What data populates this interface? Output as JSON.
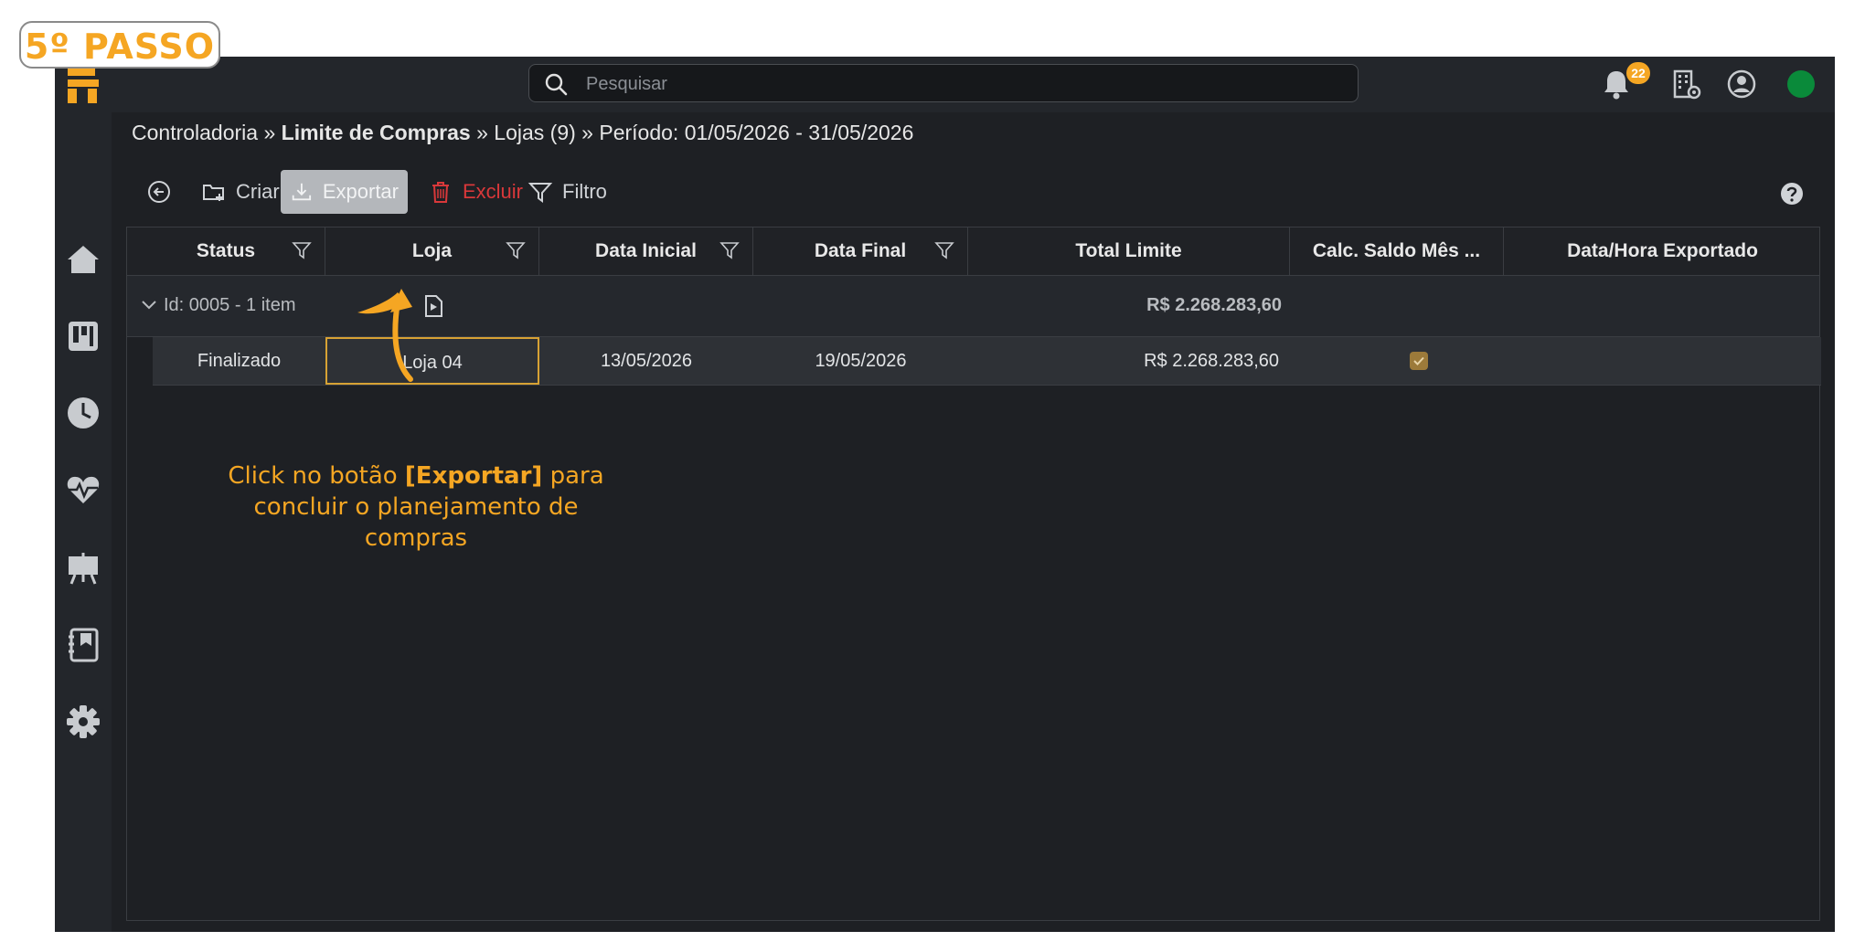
{
  "step_badge": "5º PASSO",
  "search": {
    "placeholder": "Pesquisar"
  },
  "notifications": {
    "count": "22"
  },
  "breadcrumb": {
    "part1": "Controladoria",
    "sep": " » ",
    "part2": "Limite de Compras",
    "part3": "Lojas (9)",
    "part4": "Período: 01/05/2026 - 31/05/2026"
  },
  "toolbar": {
    "create_label": "Criar",
    "export_label": "Exportar",
    "delete_label": "Excluir",
    "filter_label": "Filtro"
  },
  "table": {
    "columns": [
      "Status",
      "Loja",
      "Data Inicial",
      "Data Final",
      "Total Limite",
      "Calc. Saldo Mês ...",
      "Data/Hora Exportado"
    ],
    "group": {
      "label": "Id: 0005 - 1 item",
      "total": "R$ 2.268.283,60"
    },
    "rows": [
      {
        "status": "Finalizado",
        "loja": "Loja 04",
        "data_inicial": "13/05/2026",
        "data_final": "19/05/2026",
        "total_limite": "R$ 2.268.283,60",
        "calc_saldo": true,
        "exportado": ""
      }
    ]
  },
  "annotation": {
    "line1_pre": "Click no botão ",
    "line1_bold": "[Exportar]",
    "line1_post": " para",
    "line2": "concluir o planejamento de compras"
  },
  "colors": {
    "accent": "#f5a623",
    "danger": "#d9383a",
    "status_online": "#0a8a3a"
  }
}
